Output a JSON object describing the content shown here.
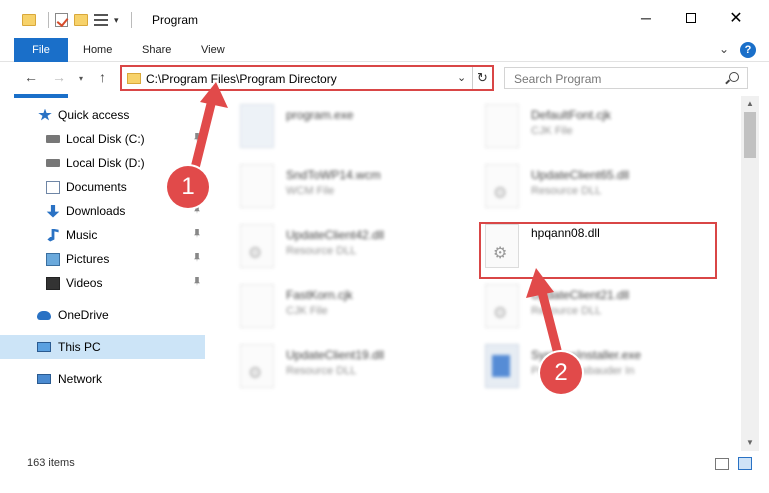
{
  "window": {
    "title": "Program",
    "minimize": "─",
    "close": "✕"
  },
  "ribbon": {
    "tabs": [
      "File",
      "Home",
      "Share",
      "View"
    ],
    "help": "?"
  },
  "address": {
    "path": "C:\\Program Files\\Program Directory",
    "search_placeholder": "Search Program"
  },
  "nav": {
    "items": [
      {
        "label": "Quick access"
      },
      {
        "label": "Local Disk (C:)"
      },
      {
        "label": "Local Disk (D:)"
      },
      {
        "label": "Documents"
      },
      {
        "label": "Downloads"
      },
      {
        "label": "Music"
      },
      {
        "label": "Pictures"
      },
      {
        "label": "Videos"
      },
      {
        "label": "OneDrive"
      },
      {
        "label": "This PC"
      },
      {
        "label": "Network"
      }
    ]
  },
  "files": [
    {
      "name": "program.exe",
      "type": ""
    },
    {
      "name": "DefaultFont.cjk",
      "type": "CJK File"
    },
    {
      "name": "SndToWP14.wcm",
      "type": "WCM File"
    },
    {
      "name": "UpdateClient65.dll",
      "type": "Resource DLL"
    },
    {
      "name": "UpdateClient42.dll",
      "type": "Resource DLL"
    },
    {
      "name": "hpqann08.dll",
      "type": ""
    },
    {
      "name": "FastKorn.cjk",
      "type": "CJK File"
    },
    {
      "name": "UpdateClient21.dll",
      "type": "Resource DLL"
    },
    {
      "name": "UpdateClient19.dll",
      "type": "Resource DLL"
    },
    {
      "name": "SystemsInstaller.exe",
      "type": "Programmsbauder In"
    }
  ],
  "status": {
    "count": "163 items"
  },
  "callouts": [
    "1",
    "2"
  ],
  "colors": {
    "accent": "#1a6fc9",
    "highlight": "#d94646",
    "callout": "#e14a4a",
    "selection": "#cce4f7"
  }
}
